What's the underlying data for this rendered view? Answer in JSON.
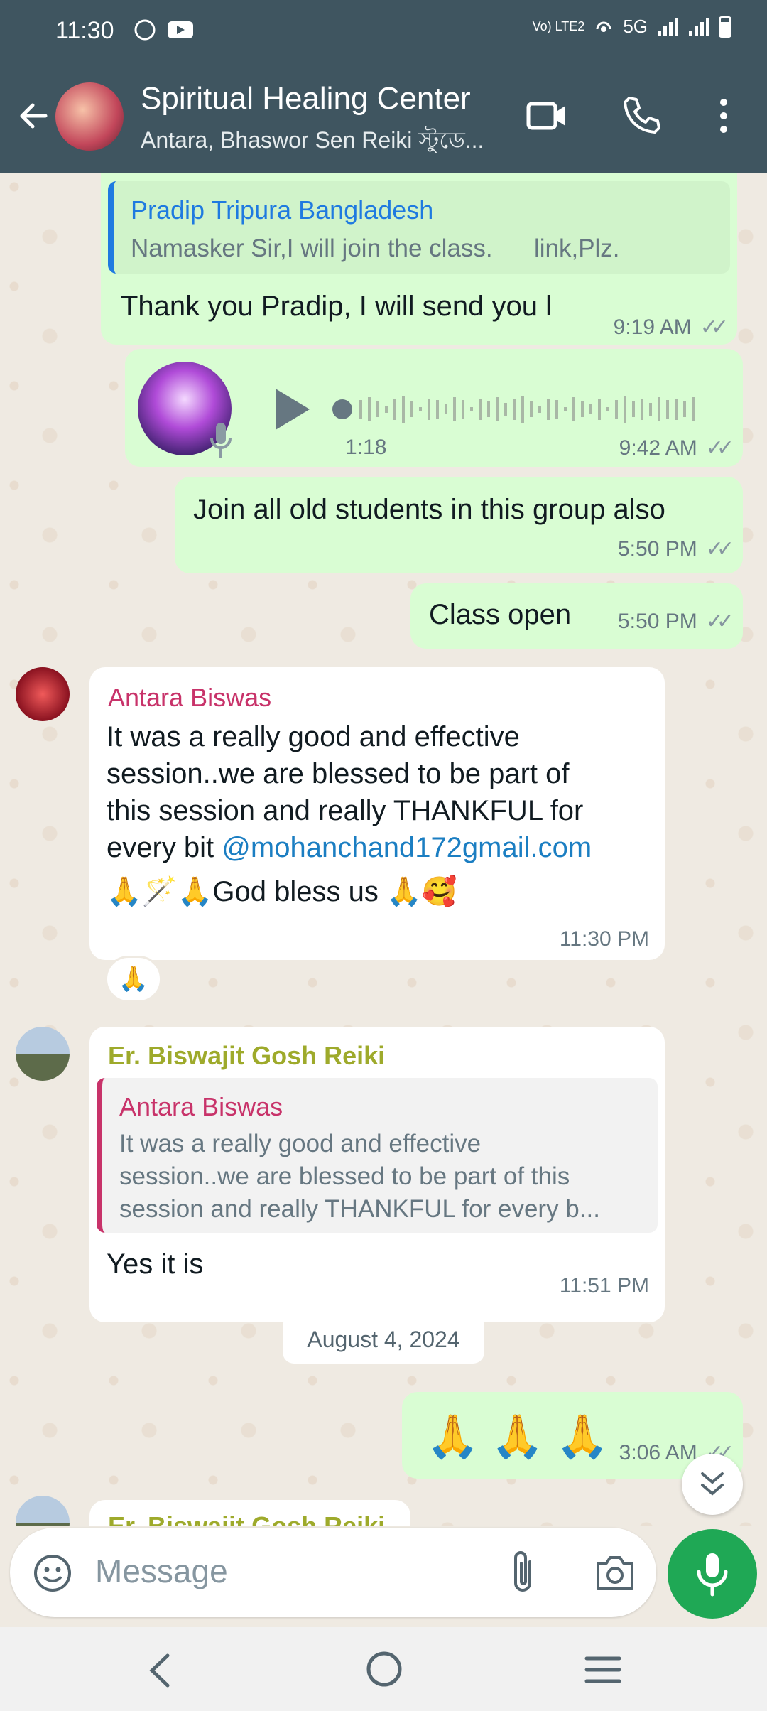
{
  "status_bar": {
    "time": "11:30",
    "network": "Vo) LTE2",
    "signal": "5G"
  },
  "header": {
    "title": "Spiritual Healing Center",
    "subtitle": "Antara, Bhaswor Sen Reiki স্টুডে..."
  },
  "messages": [
    {
      "quote_name": "Pradip Tripura Bangladesh",
      "quote_text": "Namasker Sir,I will join the class.      link,Plz.",
      "text": "Thank you Pradip, I will send you l",
      "time": "9:19 AM"
    },
    {
      "voice_duration": "1:18",
      "time": "9:42 AM"
    },
    {
      "text": "Join all old students in this group also",
      "time": "5:50 PM"
    },
    {
      "text": "Class open",
      "time": "5:50 PM"
    },
    {
      "sender": "Antara Biswas",
      "text_lines": [
        "It was a really good and effective",
        "session..we are blessed to be part of",
        "this session and really THANKFUL for",
        "every bit "
      ],
      "mention": "@mohanchand172gmail.com",
      "emoji_line": "🙏🪄🙏God bless us 🙏🥰",
      "time": "11:30 PM",
      "reaction": "🙏"
    },
    {
      "sender": "Er. Biswajit Gosh Reiki",
      "quote_name": "Antara Biswas",
      "quote_lines": [
        "It was a really good and effective",
        "session..we are blessed to be part of this",
        "session and really THANKFUL for every b..."
      ],
      "text": "Yes it is",
      "time": "11:51 PM"
    },
    {
      "text": "🙏 🙏 🙏",
      "time": "3:06 AM"
    },
    {
      "sender": "Er. Biswajit Gosh Reiki"
    }
  ],
  "date_divider": "August 4, 2024",
  "input": {
    "placeholder": "Message"
  },
  "colors": {
    "header_bg": "#3f5560",
    "outgoing_bubble": "#d9fdd3",
    "incoming_bubble": "#ffffff",
    "accent_green": "#1fa855",
    "sender_antara": "#c8336a",
    "sender_biswajit": "#9eaa2b",
    "quote_pradip": "#1f7ae0",
    "mention_link": "#1b7ec2"
  }
}
